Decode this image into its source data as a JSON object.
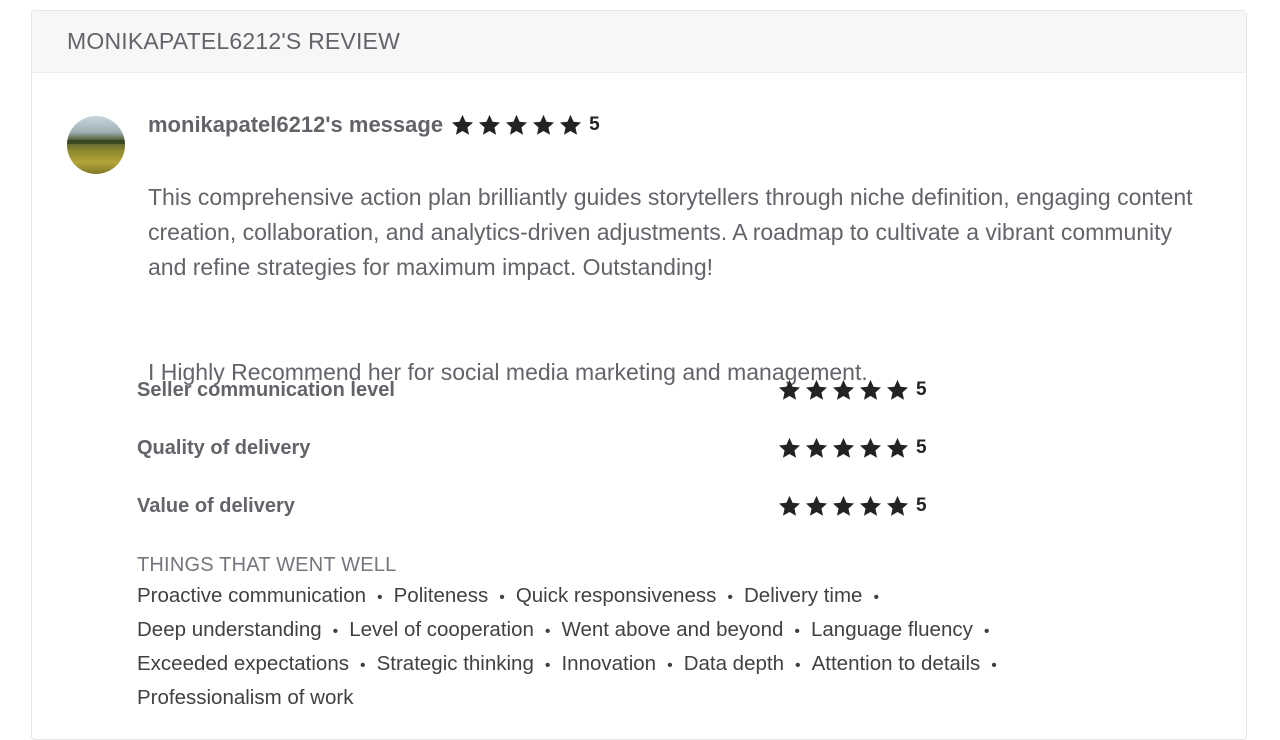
{
  "header": {
    "title": "MONIKAPATEL6212'S REVIEW"
  },
  "message": {
    "title": "monikapatel6212's message",
    "rating": 5,
    "paragraphs": [
      "This comprehensive action plan brilliantly guides storytellers through niche definition, engaging content creation, collaboration, and analytics-driven adjustments. A roadmap to cultivate a vibrant community and refine strategies for maximum impact. Outstanding!",
      "I Highly Recommend her for social media marketing and management."
    ]
  },
  "ratings": [
    {
      "label": "Seller communication level",
      "value": 5
    },
    {
      "label": "Quality of delivery",
      "value": 5
    },
    {
      "label": "Value of delivery",
      "value": 5
    }
  ],
  "went_well": {
    "heading": "THINGS THAT WENT WELL",
    "lines": [
      [
        "Proactive communication",
        "Politeness",
        "Quick responsiveness",
        "Delivery time"
      ],
      [
        "Deep understanding",
        "Level of cooperation",
        "Went above and beyond",
        "Language fluency"
      ],
      [
        "Exceeded expectations",
        "Strategic thinking",
        "Innovation",
        "Data depth",
        "Attention to details"
      ],
      [
        "Professionalism of work"
      ]
    ]
  },
  "colors": {
    "star": "#222325",
    "text": "#62646a",
    "header_bg": "#f7f7f7"
  },
  "icons": {
    "star": "star-icon",
    "avatar": "avatar-image"
  }
}
